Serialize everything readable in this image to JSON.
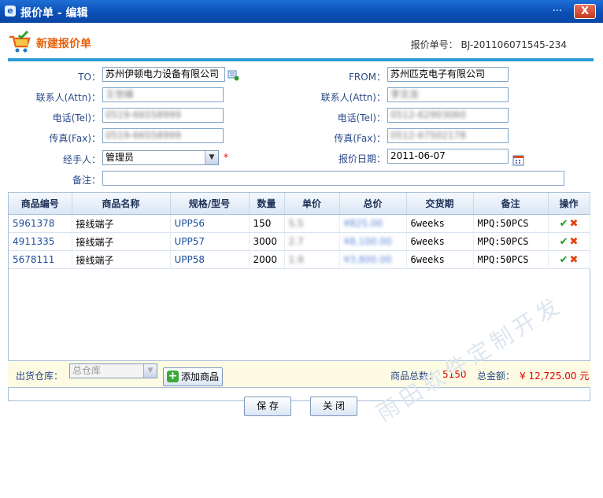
{
  "window": {
    "title": "报价单 - 编辑",
    "min_glyph": "...",
    "close_glyph": "X"
  },
  "header": {
    "heading": "新建报价单",
    "quote_no_label": "报价单号：",
    "quote_no": "BJ-201106071545-234"
  },
  "form": {
    "to_label": "TO：",
    "to_value": "苏州伊顿电力设备有限公司",
    "from_label": "FROM：",
    "from_value": "苏州匹克电子有限公司",
    "attn_label_left": "联系人(Attn)：",
    "attn_value_left": "王世峰",
    "attn_label_right": "联系人(Attn)：",
    "attn_value_right": "李文龙",
    "tel_label_left": "电话(Tel)：",
    "tel_value_left": "0519-66558999",
    "tel_label_right": "电话(Tel)：",
    "tel_value_right": "0512-62903060",
    "fax_label_left": "传真(Fax)：",
    "fax_value_left": "0519-66558999",
    "fax_label_right": "传真(Fax)：",
    "fax_value_right": "0512-67502178",
    "handler_label": "经手人：",
    "handler_value": "管理员",
    "required_mark": "*",
    "date_label": "报价日期：",
    "date_value": "2011-06-07",
    "remark_label": "备注：",
    "remark_value": ""
  },
  "table": {
    "headers": [
      "商品编号",
      "商品名称",
      "规格/型号",
      "数量",
      "单价",
      "总价",
      "交货期",
      "备注",
      "操作"
    ],
    "rows": [
      {
        "code": "5961378",
        "name": "接线端子",
        "model": "UPP56",
        "qty": "150",
        "price": "5.5",
        "total": "¥825.00",
        "delivery": "6weeks",
        "remark": "MPQ:50PCS"
      },
      {
        "code": "4911335",
        "name": "接线端子",
        "model": "UPP57",
        "qty": "3000",
        "price": "2.7",
        "total": "¥8,100.00",
        "delivery": "6weeks",
        "remark": "MPQ:50PCS"
      },
      {
        "code": "5678111",
        "name": "接线端子",
        "model": "UPP58",
        "qty": "2000",
        "price": "1.9",
        "total": "¥3,800.00",
        "delivery": "6weeks",
        "remark": "MPQ:50PCS"
      }
    ]
  },
  "footer": {
    "warehouse_label": "出货仓库：",
    "warehouse_value": "总仓库",
    "add_button": "添加商品",
    "total_qty_label": "商品总数：",
    "total_qty": "5150",
    "total_amount_label": "总金额：",
    "total_amount": "¥ 12,725.00 元"
  },
  "buttons": {
    "save": "保 存",
    "close": "关 闭"
  },
  "watermark": "雨田软件定制开发",
  "colors": {
    "accent": "#2e9bd8",
    "heading": "#e8600a",
    "titlebar": "#0a4fb6",
    "amount": "#e00000"
  }
}
